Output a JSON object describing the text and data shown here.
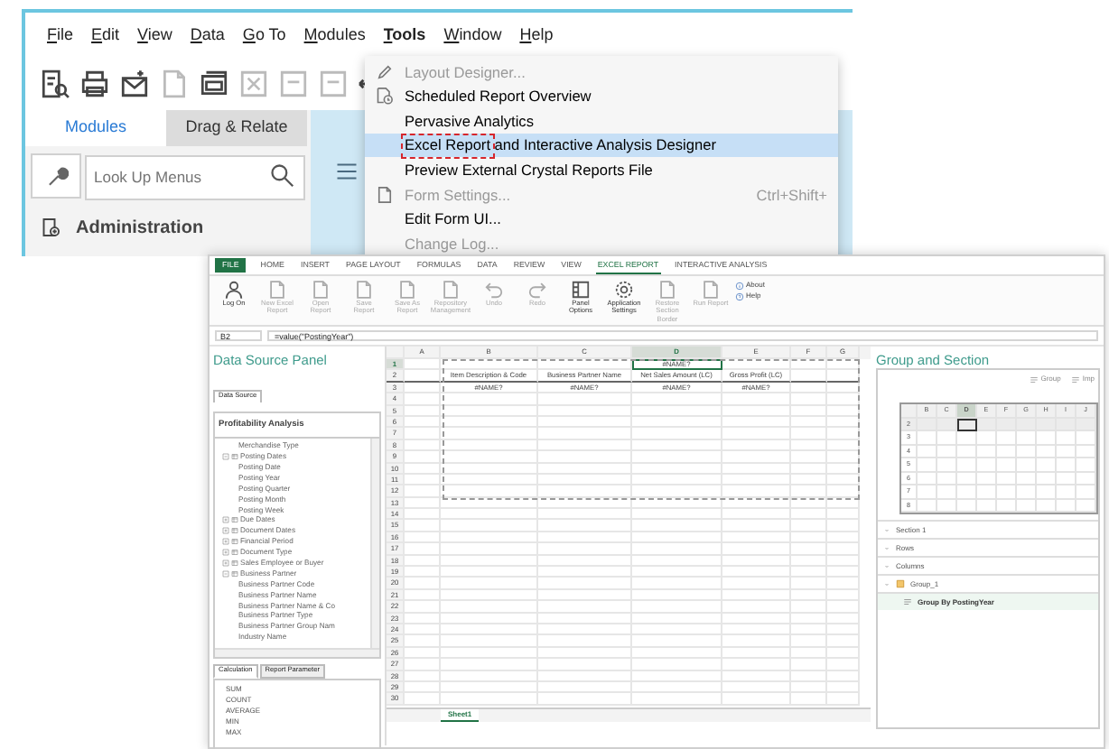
{
  "back_window": {
    "menu_bar": [
      {
        "label": "File",
        "selected": false
      },
      {
        "label": "Edit",
        "selected": false
      },
      {
        "label": "View",
        "selected": false
      },
      {
        "label": "Data",
        "selected": false
      },
      {
        "label": "Go To",
        "selected": false
      },
      {
        "label": "Modules",
        "selected": false
      },
      {
        "label": "Tools",
        "selected": true
      },
      {
        "label": "Window",
        "selected": false
      },
      {
        "label": "Help",
        "selected": false
      }
    ],
    "sidebar": {
      "tabs": [
        {
          "label": "Modules",
          "selected": true
        },
        {
          "label": "Drag & Relate",
          "selected": false
        }
      ],
      "search": {
        "placeholder": "Look Up Menus"
      },
      "items": [
        "Administration"
      ]
    },
    "tools_menu": {
      "items": [
        {
          "label": "Layout Designer...",
          "disabled": true,
          "selected": false,
          "annotated": false
        },
        {
          "label": "Scheduled Report Overview",
          "disabled": false,
          "selected": false,
          "annotated": false
        },
        {
          "label": "Pervasive Analytics",
          "disabled": false,
          "selected": false,
          "annotated": false
        },
        {
          "label": "Excel Report and Interactive Analysis Designer",
          "disabled": false,
          "selected": true,
          "annotated": true
        },
        {
          "label": "Preview External Crystal Reports File",
          "disabled": false,
          "selected": false,
          "annotated": false
        },
        {
          "label": "Form Settings...",
          "shortcut": "Ctrl+Shift+",
          "disabled": true,
          "selected": false,
          "annotated": false
        },
        {
          "label": "Edit Form UI...",
          "disabled": false,
          "selected": false,
          "annotated": false
        },
        {
          "label": "Change Log...",
          "disabled": true,
          "selected": false,
          "annotated": false
        }
      ]
    }
  },
  "excel": {
    "ribbon_tabs": [
      {
        "label": "FILE",
        "kind": "file",
        "selected": false
      },
      {
        "label": "HOME",
        "kind": "tab",
        "selected": false
      },
      {
        "label": "INSERT",
        "kind": "tab",
        "selected": false
      },
      {
        "label": "PAGE LAYOUT",
        "kind": "tab",
        "selected": false
      },
      {
        "label": "FORMULAS",
        "kind": "tab",
        "selected": false
      },
      {
        "label": "DATA",
        "kind": "tab",
        "selected": false
      },
      {
        "label": "REVIEW",
        "kind": "tab",
        "selected": false
      },
      {
        "label": "VIEW",
        "kind": "tab",
        "selected": false
      },
      {
        "label": "EXCEL REPORT",
        "kind": "tab",
        "selected": true
      },
      {
        "label": "INTERACTIVE ANALYSIS",
        "kind": "tab",
        "selected": false
      }
    ],
    "ribbon_buttons": [
      {
        "label": "Log On",
        "disabled": false
      },
      {
        "label": "New Excel Report",
        "disabled": true
      },
      {
        "label": "Open Report",
        "disabled": true
      },
      {
        "label": "Save Report",
        "disabled": true
      },
      {
        "label": "Save As Report",
        "disabled": true
      },
      {
        "label": "Repository Management",
        "disabled": true
      },
      {
        "label": "Undo",
        "disabled": true
      },
      {
        "label": "Redo",
        "disabled": true
      },
      {
        "label": "Panel Options",
        "disabled": false
      },
      {
        "label": "Application Settings",
        "disabled": false
      },
      {
        "label": "Restore Section Border",
        "disabled": true
      },
      {
        "label": "Run Report",
        "disabled": true
      }
    ],
    "small_buttons": [
      "About",
      "Help"
    ],
    "name_box": "B2",
    "formula": "=value(\"PostingYear\")",
    "data_source_panel": {
      "title": "Data Source Panel",
      "tab": "Data Source",
      "source": "Profitability Analysis",
      "tree": [
        {
          "label": "Merchandise Type"
        },
        {
          "label": "Posting Dates",
          "expanded": true,
          "children": [
            {
              "label": "Posting Date"
            },
            {
              "label": "Posting Year"
            },
            {
              "label": "Posting Quarter"
            },
            {
              "label": "Posting Month"
            },
            {
              "label": "Posting Week"
            }
          ]
        },
        {
          "label": "Due Dates",
          "expanded": false
        },
        {
          "label": "Document Dates",
          "expanded": false
        },
        {
          "label": "Financial Period",
          "expanded": false
        },
        {
          "label": "Document Type",
          "expanded": false
        },
        {
          "label": "Sales Employee or Buyer",
          "expanded": false
        },
        {
          "label": "Business Partner",
          "expanded": true,
          "children": [
            {
              "label": "Business Partner Code"
            },
            {
              "label": "Business Partner Name"
            },
            {
              "label": "Business Partner Name & Co"
            },
            {
              "label": "Business Partner Type"
            },
            {
              "label": "Business Partner Group Nam"
            },
            {
              "label": "Industry Name"
            }
          ]
        }
      ],
      "bottom_tabs": [
        {
          "label": "Calculation",
          "selected": true
        },
        {
          "label": "Report Parameter",
          "selected": false
        }
      ],
      "functions": [
        "SUM",
        "COUNT",
        "AVERAGE",
        "MIN",
        "MAX"
      ]
    },
    "sheet": {
      "columns": [
        {
          "label": "A",
          "selected": false
        },
        {
          "label": "B",
          "selected": false
        },
        {
          "label": "C",
          "selected": false
        },
        {
          "label": "D",
          "selected": true
        },
        {
          "label": "E",
          "selected": false
        },
        {
          "label": "F",
          "selected": false
        },
        {
          "label": "G",
          "selected": false
        }
      ],
      "rows": [
        {
          "number": "1",
          "selected": true,
          "cells": [
            null,
            null,
            null,
            "#NAME?"
          ]
        },
        {
          "number": "2",
          "selected": false,
          "cells": [
            null,
            "Item Description & Code",
            "Business Partner Name",
            "Net Sales Amount (LC)",
            "Gross Profit (LC)"
          ]
        },
        {
          "number": "3",
          "selected": false,
          "cells": [
            null,
            "#NAME?",
            "#NAME?",
            "#NAME?",
            "#NAME?"
          ]
        },
        {
          "number": "4",
          "selected": false
        },
        {
          "number": "5",
          "selected": false
        },
        {
          "number": "6",
          "selected": false
        },
        {
          "number": "7",
          "selected": false
        },
        {
          "number": "8",
          "selected": false
        },
        {
          "number": "9",
          "selected": false
        },
        {
          "number": "10",
          "selected": false
        },
        {
          "number": "11",
          "selected": false
        },
        {
          "number": "12",
          "selected": false
        },
        {
          "number": "13",
          "selected": false
        },
        {
          "number": "14",
          "selected": false
        },
        {
          "number": "15",
          "selected": false
        },
        {
          "number": "16",
          "selected": false
        },
        {
          "number": "17",
          "selected": false
        },
        {
          "number": "18",
          "selected": false
        },
        {
          "number": "19",
          "selected": false
        },
        {
          "number": "20",
          "selected": false
        },
        {
          "number": "21",
          "selected": false
        },
        {
          "number": "22",
          "selected": false
        },
        {
          "number": "23",
          "selected": false
        },
        {
          "number": "24",
          "selected": false
        },
        {
          "number": "25",
          "selected": false
        },
        {
          "number": "26",
          "selected": false
        },
        {
          "number": "27",
          "selected": false
        },
        {
          "number": "28",
          "selected": false
        },
        {
          "number": "29",
          "selected": false
        },
        {
          "number": "30",
          "selected": false
        }
      ],
      "sheet_tabs": [
        {
          "label": "Sheet1",
          "selected": true
        }
      ]
    },
    "group_panel": {
      "title": "Group and Section",
      "toolbar": [
        "Group",
        "Imp"
      ],
      "grid": {
        "columns": [
          {
            "label": "B",
            "selected": false
          },
          {
            "label": "C",
            "selected": false
          },
          {
            "label": "D",
            "selected": true
          },
          {
            "label": "E",
            "selected": false
          },
          {
            "label": "F",
            "selected": false
          },
          {
            "label": "G",
            "selected": false
          },
          {
            "label": "H",
            "selected": false
          },
          {
            "label": "I",
            "selected": false
          },
          {
            "label": "J",
            "selected": false
          }
        ],
        "rows": [
          {
            "number": "2",
            "selected": true
          },
          {
            "number": "3",
            "selected": false
          },
          {
            "number": "4",
            "selected": false
          },
          {
            "number": "5",
            "selected": false
          },
          {
            "number": "6",
            "selected": false
          },
          {
            "number": "7",
            "selected": false
          },
          {
            "number": "8",
            "selected": false
          }
        ]
      },
      "items": [
        {
          "label": "Section 1",
          "kind": "section",
          "selected": false
        },
        {
          "label": "Rows",
          "kind": "section",
          "selected": false
        },
        {
          "label": "Columns",
          "kind": "section",
          "selected": false
        },
        {
          "label": "Group_1",
          "kind": "group",
          "selected": false
        },
        {
          "label": "Group By PostingYear",
          "kind": "grouping",
          "selected": true
        }
      ]
    }
  }
}
